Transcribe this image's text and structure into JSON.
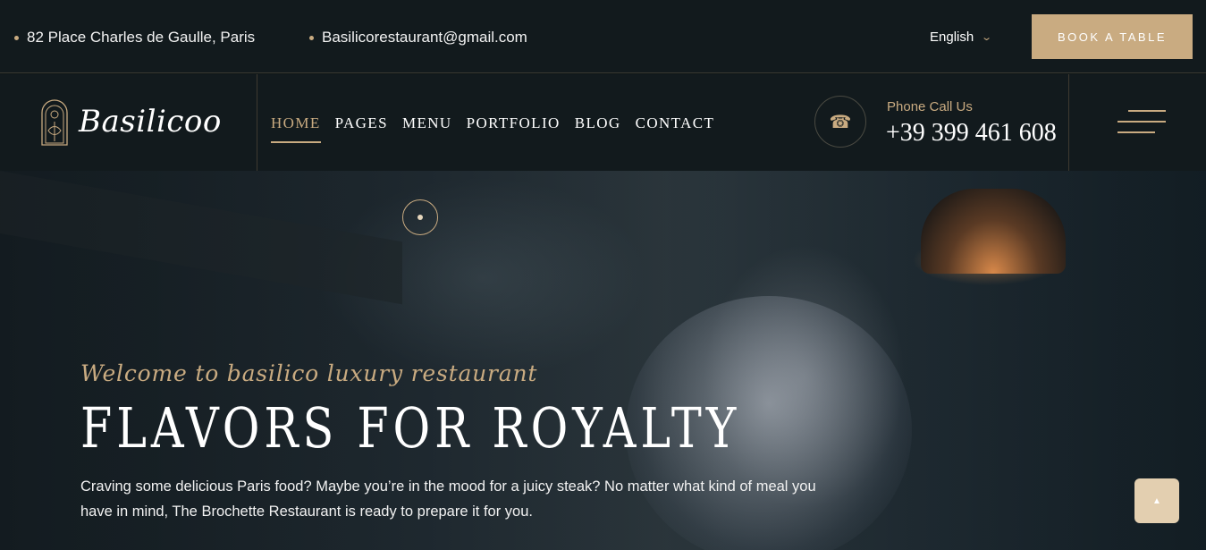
{
  "topbar": {
    "address": "82 Place Charles de Gaulle, Paris",
    "email": "Basilicorestaurant@gmail.com",
    "language": "English",
    "book_label": "BOOK A TABLE"
  },
  "brand": {
    "name": "Basilicoo",
    "accent_color": "#c9ab81",
    "dark_color": "#121a1d"
  },
  "nav": {
    "items": [
      {
        "label": "HOME",
        "active": true
      },
      {
        "label": "PAGES",
        "active": false
      },
      {
        "label": "MENU",
        "active": false
      },
      {
        "label": "PORTFOLIO",
        "active": false
      },
      {
        "label": "BLOG",
        "active": false
      },
      {
        "label": "CONTACT",
        "active": false
      }
    ],
    "phone_label": "Phone Call Us",
    "phone_number": "+39 399 461 608",
    "phone_icon": "phone-icon",
    "menu_icon": "hamburger-icon"
  },
  "hero": {
    "welcome": "Welcome to basilico luxury restaurant",
    "headline": "FLAVORS FOR ROYALTY",
    "description": "Craving some delicious Paris food? Maybe you’re in the mood for a juicy steak? No matter what kind of meal you have in mind, The Brochette Restaurant is ready to prepare it for you."
  },
  "scroll_top_icon": "arrow-up-icon"
}
